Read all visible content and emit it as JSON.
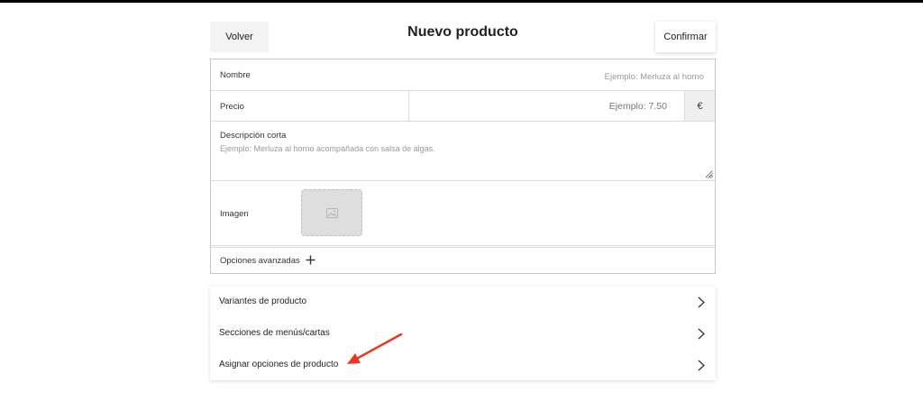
{
  "header": {
    "back_label": "Volver",
    "title": "Nuevo producto",
    "confirm_label": "Confirmar"
  },
  "form": {
    "name": {
      "label": "Nombre",
      "placeholder": "Ejemplo: Merluza al horno",
      "value": ""
    },
    "price": {
      "label": "Precio",
      "placeholder": "Ejemplo: 7.50",
      "value": "",
      "currency": "€"
    },
    "description": {
      "label": "Descripción corta",
      "placeholder": "Ejemplo: Merluza al horno acompañada con salsa de algas.",
      "value": ""
    },
    "image": {
      "label": "Imagen",
      "icon": "image-placeholder-icon"
    },
    "advanced": {
      "label": "Opciones avanzadas",
      "icon": "plus-icon"
    }
  },
  "links": [
    {
      "label": "Variantes de producto",
      "icon": "chevron-right-icon"
    },
    {
      "label": "Secciones de menús/cartas",
      "icon": "chevron-right-icon"
    },
    {
      "label": "Asignar opciones de producto",
      "icon": "chevron-right-icon"
    }
  ],
  "annotation": {
    "icon": "red-arrow-icon",
    "color": "#e8381f"
  },
  "colors": {
    "top_bar": "#000000",
    "back_button_bg": "#f3f3f3",
    "currency_bg": "#efefef",
    "image_placeholder_bg": "#dedede",
    "border": "#c8c8c8"
  }
}
